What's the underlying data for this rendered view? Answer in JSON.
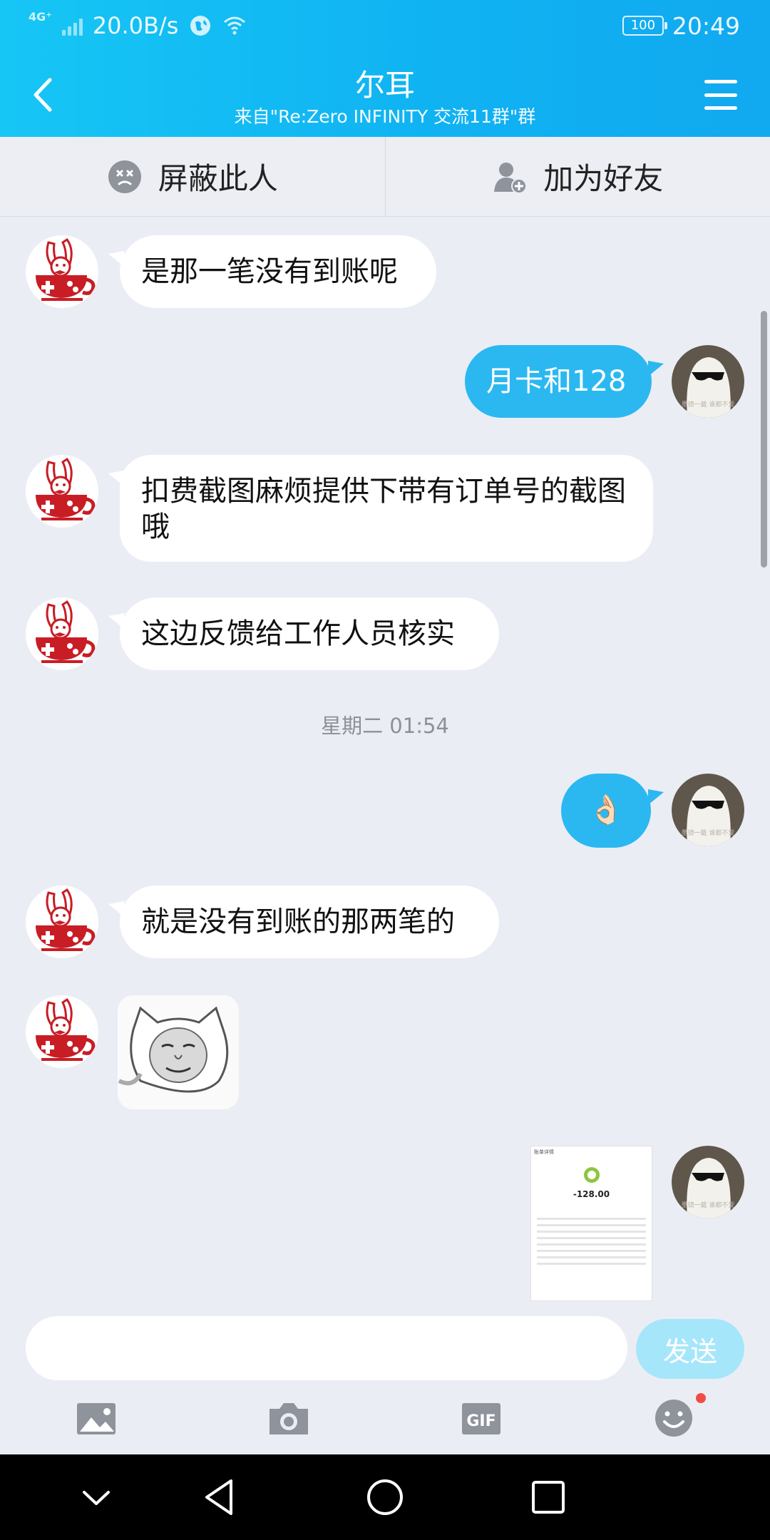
{
  "status_bar": {
    "network": "4G⁺",
    "speed": "20.0B/s",
    "battery": "100",
    "time": "20:49"
  },
  "header": {
    "title": "尔耳",
    "subtitle": "来自\"Re:Zero INFINITY 交流11群\"群"
  },
  "actions": {
    "block": "屏蔽此人",
    "add_friend": "加为好友"
  },
  "messages": [
    {
      "side": "in",
      "text": "是那一笔没有到账呢"
    },
    {
      "side": "out",
      "text": "月卡和128"
    },
    {
      "side": "in",
      "text": "扣费截图麻烦提供下带有订单号的截图哦"
    },
    {
      "side": "in",
      "text": "这边反馈给工作人员核实"
    },
    {
      "side": "out",
      "text": "👌🏻"
    },
    {
      "side": "in",
      "text": "就是没有到账的那两笔的"
    }
  ],
  "timestamp": "星期二 01:54",
  "screenshot_preview": {
    "header": "账单详情",
    "amount": "-128.00"
  },
  "input": {
    "placeholder": "",
    "value": "",
    "send_label": "发送"
  },
  "icons": {
    "tools": [
      "image-icon",
      "camera-icon",
      "gif-icon",
      "emoji-icon"
    ],
    "nav": [
      "chevron-down-icon",
      "back-triangle-icon",
      "home-circle-icon",
      "recents-square-icon"
    ]
  },
  "colors": {
    "header": "#10b3f2",
    "outgoing_bubble": "#2bb8f1",
    "incoming_bubble": "#ffffff",
    "background": "#ebedf5"
  }
}
